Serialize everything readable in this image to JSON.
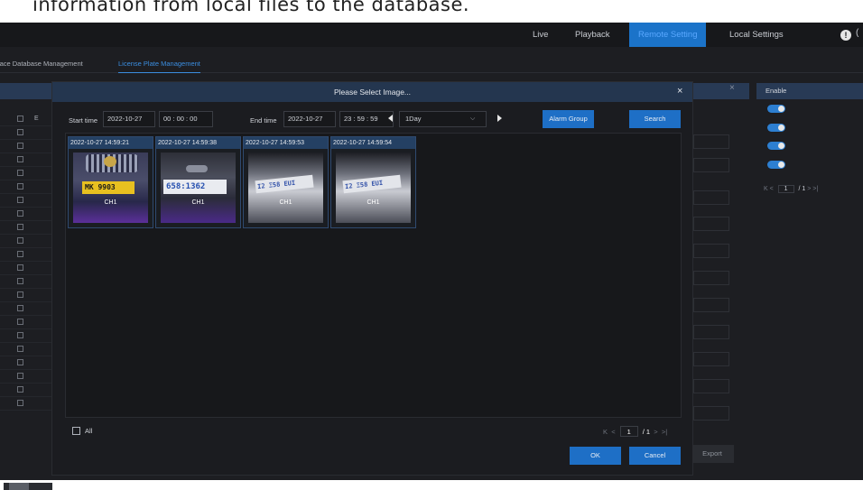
{
  "document": {
    "caption": "information from local files to the database."
  },
  "nav": {
    "items": [
      {
        "label": "Live"
      },
      {
        "label": "Playback"
      },
      {
        "label": "Remote Setting"
      },
      {
        "label": "Local Settings"
      }
    ],
    "cut_text": "("
  },
  "subtabs": [
    {
      "label": "Face Database Management"
    },
    {
      "label": "License Plate Management"
    }
  ],
  "background_table": {
    "col_label": "E"
  },
  "right_panel": {
    "header": "Enable",
    "page_current": "1",
    "page_total": "/ 1",
    "prev": "K  <",
    "next": ">  >|"
  },
  "export_button": "Export",
  "modal": {
    "title": "Please Select Image...",
    "close": "×",
    "start_label": "Start time",
    "start_date": "2022-10-27",
    "start_time": "00 : 00 : 00",
    "end_label": "End time",
    "end_date": "2022-10-27",
    "end_time": "23 : 59 : 59",
    "period": "1Day",
    "alarm_group_btn": "Alarm Group",
    "search_btn": "Search",
    "thumbnails": [
      {
        "timestamp": "2022-10-27 14:59:21",
        "channel": "CH1",
        "plate": "MK 9903"
      },
      {
        "timestamp": "2022-10-27 14:59:38",
        "channel": "CH1",
        "plate": "658:1362"
      },
      {
        "timestamp": "2022-10-27 14:59:53",
        "channel": "CH1",
        "plate": "I2 Ξ58 EUI"
      },
      {
        "timestamp": "2022-10-27 14:59:54",
        "channel": "CH1",
        "plate": "I2 Ξ58 EUI"
      }
    ],
    "all_label": "All",
    "pager": {
      "first": "K",
      "prev": "<",
      "current": "1",
      "total": "/ 1",
      "next": ">",
      "last": ">|"
    },
    "ok_btn": "OK",
    "cancel_btn": "Cancel"
  },
  "colors": {
    "accent": "#1e6fc6",
    "header_bar": "#24364f",
    "background": "#1d1e22"
  }
}
